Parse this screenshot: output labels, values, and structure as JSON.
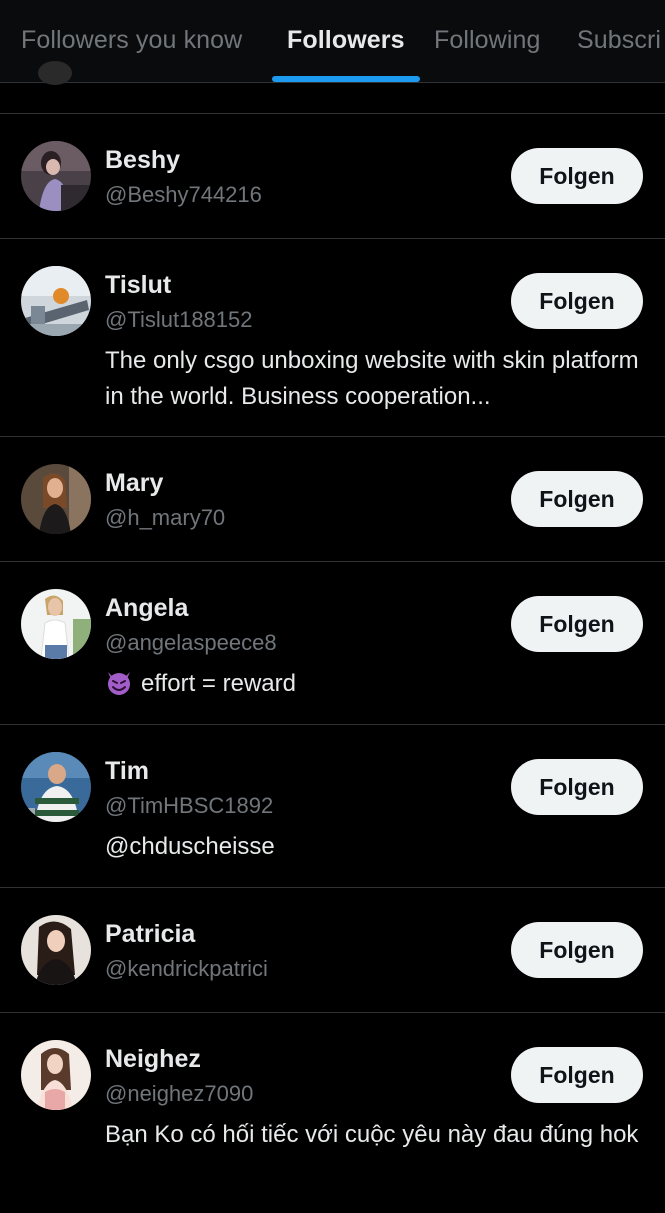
{
  "tabs": [
    {
      "label": "Followers you know",
      "active": false
    },
    {
      "label": "Followers",
      "active": true
    },
    {
      "label": "Following",
      "active": false
    },
    {
      "label": "Subscri",
      "active": false
    }
  ],
  "accent_color": "#1d9bf0",
  "follow_label": "Folgen",
  "users": [
    {
      "name": "Beshy",
      "handle": "@Beshy744216",
      "bio": ""
    },
    {
      "name": "Tislut",
      "handle": "@Tislut188152",
      "bio": "The only csgo unboxing website with skin platform in the world. Business cooperation..."
    },
    {
      "name": "Mary",
      "handle": "@h_mary70",
      "bio": ""
    },
    {
      "name": "Angela",
      "handle": "@angelaspeece8",
      "bio": "effort = reward",
      "bio_emoji": "smiling-devil-emoji"
    },
    {
      "name": "Tim",
      "handle": "@TimHBSC1892",
      "bio": "@chduscheisse"
    },
    {
      "name": "Patricia",
      "handle": "@kendrickpatrici",
      "bio": ""
    },
    {
      "name": "Neighez",
      "handle": "@neighez7090",
      "bio": "Bạn Ko có hối tiếc với cuộc yêu này đau đúng hok"
    }
  ]
}
